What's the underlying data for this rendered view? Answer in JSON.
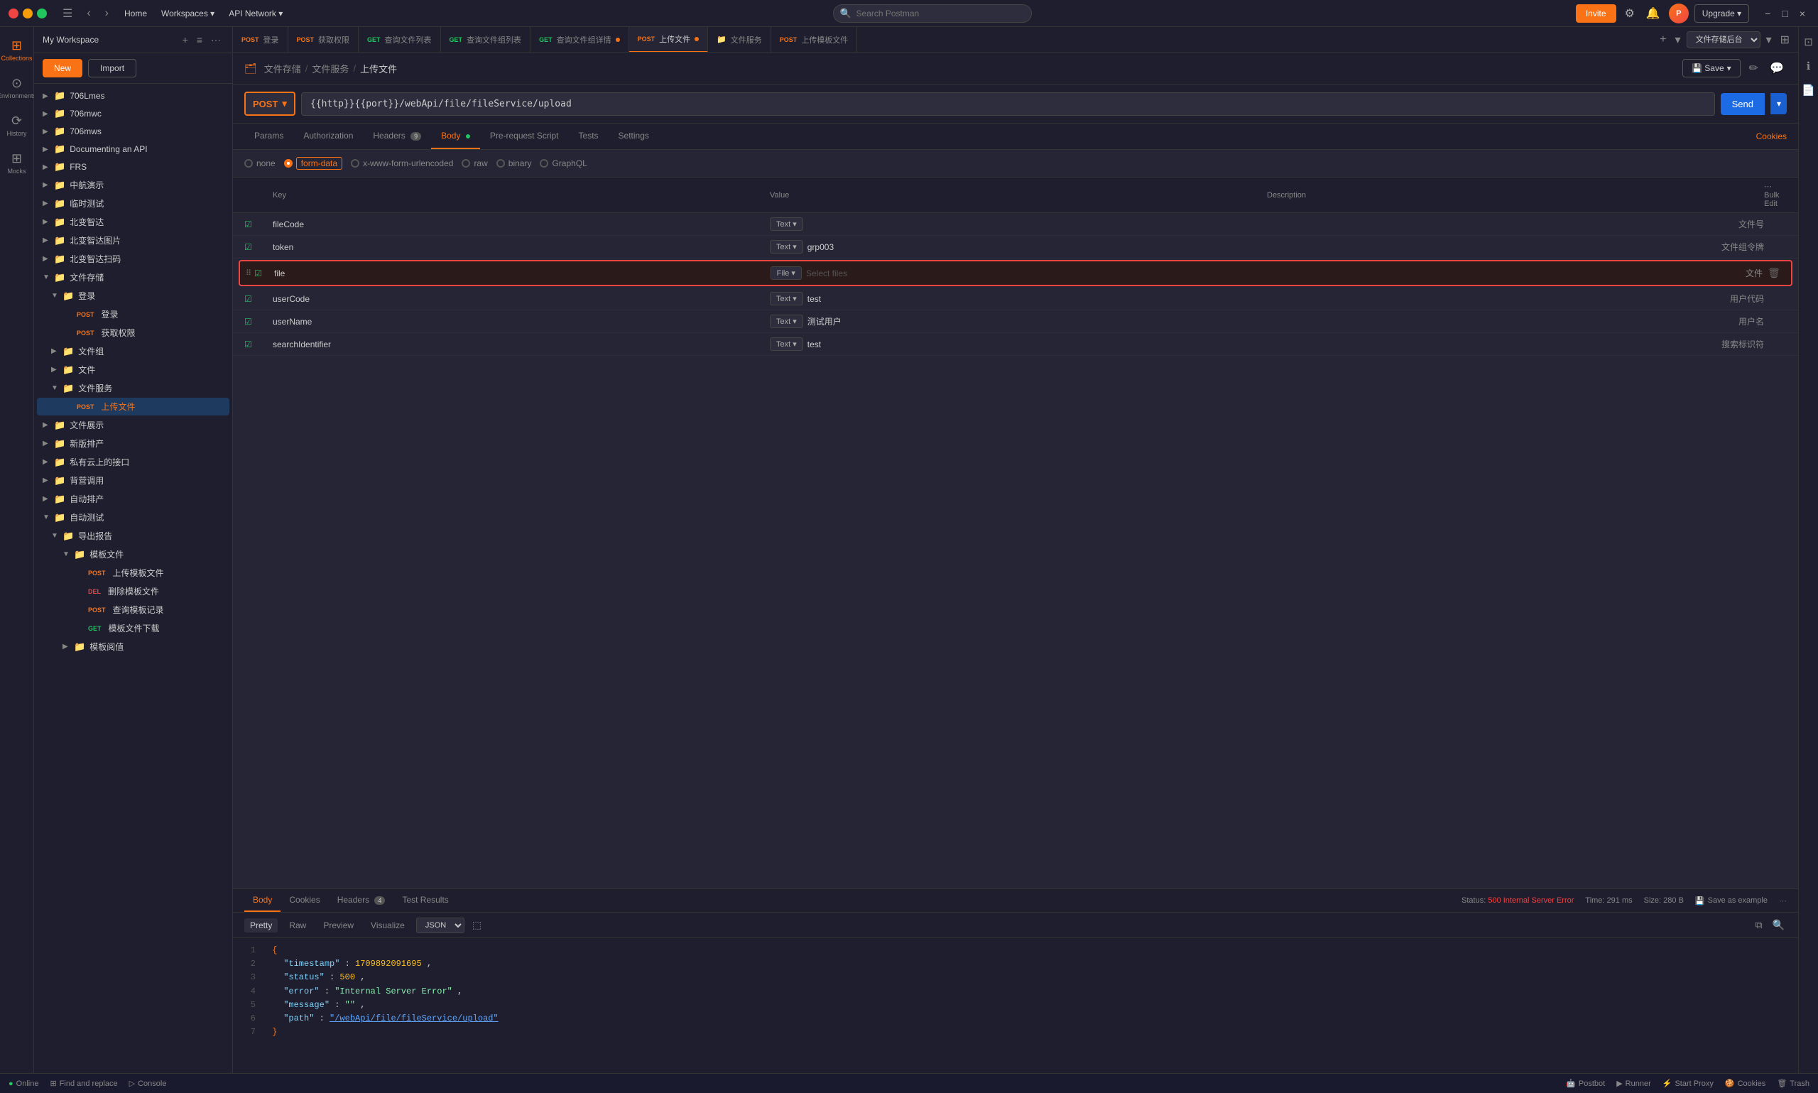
{
  "titleBar": {
    "navBack": "←",
    "navForward": "→",
    "menuHome": "Home",
    "menuWorkspaces": "Workspaces",
    "menuApiNetwork": "API Network",
    "searchPlaceholder": "Search Postman",
    "inviteBtn": "Invite",
    "upgradeBtn": "Upgrade",
    "minimizeBtn": "−",
    "maximizeBtn": "□",
    "closeBtn": "×"
  },
  "sidebar": {
    "collectionsLabel": "Collections",
    "historyLabel": "History",
    "environmentsLabel": "Environments",
    "mocksLabel": "Mocks",
    "addBtn": "+",
    "filterBtn": "≡",
    "moreBtn": "···",
    "collections": [
      {
        "name": "706Lmes",
        "level": 0,
        "type": "folder",
        "expanded": false
      },
      {
        "name": "706mwc",
        "level": 0,
        "type": "folder",
        "expanded": false
      },
      {
        "name": "706mws",
        "level": 0,
        "type": "folder",
        "expanded": false
      },
      {
        "name": "Documenting an API",
        "level": 0,
        "type": "folder",
        "expanded": false
      },
      {
        "name": "FRS",
        "level": 0,
        "type": "folder",
        "expanded": false
      },
      {
        "name": "中航演示",
        "level": 0,
        "type": "folder",
        "expanded": false
      },
      {
        "name": "临时测试",
        "level": 0,
        "type": "folder",
        "expanded": false
      },
      {
        "name": "北变智达",
        "level": 0,
        "type": "folder",
        "expanded": false
      },
      {
        "name": "北变智达图片",
        "level": 0,
        "type": "folder",
        "expanded": false
      },
      {
        "name": "北变智达扫码",
        "level": 0,
        "type": "folder",
        "expanded": false
      },
      {
        "name": "文件存储",
        "level": 0,
        "type": "folder",
        "expanded": true
      },
      {
        "name": "登录",
        "level": 1,
        "type": "folder",
        "expanded": true
      },
      {
        "name": "登录",
        "level": 2,
        "type": "request",
        "method": "POST"
      },
      {
        "name": "获取权限",
        "level": 2,
        "type": "request",
        "method": "POST"
      },
      {
        "name": "文件组",
        "level": 1,
        "type": "folder",
        "expanded": false
      },
      {
        "name": "文件",
        "level": 1,
        "type": "folder",
        "expanded": false
      },
      {
        "name": "文件服务",
        "level": 1,
        "type": "folder",
        "expanded": true
      },
      {
        "name": "上传文件",
        "level": 2,
        "type": "request",
        "method": "POST",
        "active": true
      },
      {
        "name": "文件展示",
        "level": 0,
        "type": "folder",
        "expanded": false
      },
      {
        "name": "新版排产",
        "level": 0,
        "type": "folder",
        "expanded": false
      },
      {
        "name": "私有云上的接口",
        "level": 0,
        "type": "folder",
        "expanded": false
      },
      {
        "name": "背营调用",
        "level": 0,
        "type": "folder",
        "expanded": false
      },
      {
        "name": "自动排产",
        "level": 0,
        "type": "folder",
        "expanded": false
      },
      {
        "name": "自动测试",
        "level": 0,
        "type": "folder",
        "expanded": true
      },
      {
        "name": "导出报告",
        "level": 1,
        "type": "folder",
        "expanded": true
      },
      {
        "name": "模板文件",
        "level": 2,
        "type": "folder",
        "expanded": true
      },
      {
        "name": "上传模板文件",
        "level": 3,
        "type": "request",
        "method": "POST"
      },
      {
        "name": "删除模板文件",
        "level": 3,
        "type": "request",
        "method": "DEL"
      },
      {
        "name": "查询模板记录",
        "level": 3,
        "type": "request",
        "method": "POST"
      },
      {
        "name": "模板文件下载",
        "level": 3,
        "type": "request",
        "method": "GET"
      },
      {
        "name": "模板阅值",
        "level": 2,
        "type": "folder",
        "expanded": false
      }
    ]
  },
  "tabs": [
    {
      "method": "POST",
      "methodColor": "post",
      "label": "登录",
      "active": false
    },
    {
      "method": "POST",
      "methodColor": "post",
      "label": "获取权限",
      "active": false
    },
    {
      "method": "GET",
      "methodColor": "get",
      "label": "查询文件列表",
      "active": false
    },
    {
      "method": "GET",
      "methodColor": "get",
      "label": "查询文件组列表",
      "active": false
    },
    {
      "method": "GET",
      "methodColor": "get",
      "label": "查询文件组详情",
      "active": false,
      "hasDot": true
    },
    {
      "method": "POST",
      "methodColor": "post",
      "label": "上传文件",
      "active": true,
      "hasDot": true
    },
    {
      "method": "",
      "methodColor": "",
      "label": "文件服务",
      "active": false,
      "isFolder": true
    },
    {
      "method": "POST",
      "methodColor": "post",
      "label": "上传模板文件",
      "active": false
    }
  ],
  "workspaceSelect": "文件存储后台",
  "breadcrumb": {
    "icon": "🗂",
    "part1": "文件存储",
    "sep1": "/",
    "part2": "文件服务",
    "sep2": "/",
    "current": "上传文件"
  },
  "requestBar": {
    "method": "POST",
    "url": "{{http}}{{port}}/webApi/file/fileService/upload",
    "sendLabel": "Send"
  },
  "requestTabs": {
    "params": "Params",
    "authorization": "Authorization",
    "headers": "Headers",
    "headersCount": "9",
    "body": "Body",
    "preRequestScript": "Pre-request Script",
    "tests": "Tests",
    "settings": "Settings",
    "cookiesLink": "Cookies"
  },
  "bodyOptions": {
    "none": "none",
    "formData": "form-data",
    "xWwwFormUrlencoded": "x-www-form-urlencoded",
    "raw": "raw",
    "binary": "binary",
    "graphql": "GraphQL"
  },
  "formTable": {
    "headers": {
      "key": "Key",
      "value": "Value",
      "description": "Description",
      "bulkEdit": "Bulk Edit"
    },
    "rows": [
      {
        "checked": true,
        "key": "fileCode",
        "type": "Text",
        "value": "",
        "description": "文件号",
        "highlighted": false
      },
      {
        "checked": true,
        "key": "token",
        "type": "Text",
        "value": "grp003",
        "description": "文件组令牌",
        "highlighted": false
      },
      {
        "checked": true,
        "key": "file",
        "type": "File",
        "value": "Select files",
        "description": "文件",
        "highlighted": true,
        "isFile": true
      },
      {
        "checked": true,
        "key": "userCode",
        "type": "Text",
        "value": "test",
        "description": "用户代码",
        "highlighted": false
      },
      {
        "checked": true,
        "key": "userName",
        "type": "Text",
        "value": "测试用户",
        "description": "用户名",
        "highlighted": false
      },
      {
        "checked": true,
        "key": "searchIdentifier",
        "type": "Text",
        "value": "test",
        "description": "搜索标识符",
        "highlighted": false
      }
    ]
  },
  "responseTabs": {
    "body": "Body",
    "cookies": "Cookies",
    "headers": "Headers",
    "headersCount": "4",
    "testResults": "Test Results",
    "pretty": "Pretty",
    "raw": "Raw",
    "preview": "Preview",
    "visualize": "Visualize"
  },
  "responseStatus": {
    "statusLabel": "Status:",
    "status": "500 Internal Server Error",
    "timeLabel": "Time:",
    "time": "291 ms",
    "sizeLabel": "Size:",
    "size": "280 B",
    "saveExample": "Save as example"
  },
  "responseJson": {
    "lines": [
      {
        "num": 1,
        "content": "{",
        "type": "brace"
      },
      {
        "num": 2,
        "content": "\"timestamp\": 1709892091695,",
        "keyPart": "\"timestamp\"",
        "valuePart": "1709892091695",
        "type": "number"
      },
      {
        "num": 3,
        "content": "\"status\": 500,",
        "keyPart": "\"status\"",
        "valuePart": "500",
        "type": "number"
      },
      {
        "num": 4,
        "content": "\"error\": \"Internal Server Error\",",
        "keyPart": "\"error\"",
        "valuePart": "\"Internal Server Error\"",
        "type": "string"
      },
      {
        "num": 5,
        "content": "\"message\": \"\",",
        "keyPart": "\"message\"",
        "valuePart": "\"\"",
        "type": "string"
      },
      {
        "num": 6,
        "content": "\"path\": \"/webApi/file/fileService/upload\"",
        "keyPart": "\"path\"",
        "valuePart": "\"/webApi/file/fileService/upload\"",
        "type": "url"
      },
      {
        "num": 7,
        "content": "}",
        "type": "brace"
      }
    ]
  },
  "statusBar": {
    "onlineLabel": "Online",
    "findReplaceLabel": "Find and replace",
    "consoleLabel": "Console",
    "postbotLabel": "Postbot",
    "runnerLabel": "Runner",
    "startProxyLabel": "Start Proxy",
    "cookiesLabel": "Cookies",
    "trashLabel": "Trash"
  }
}
